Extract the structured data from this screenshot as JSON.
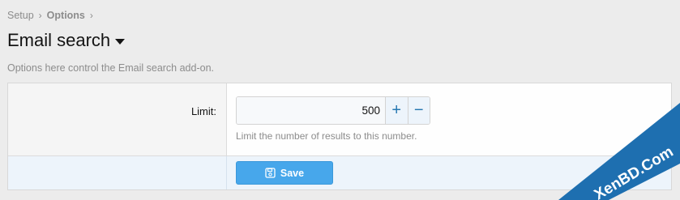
{
  "breadcrumb": {
    "items": [
      "Setup",
      "Options"
    ],
    "separator": "›"
  },
  "page": {
    "title": "Email search",
    "description": "Options here control the Email search add-on."
  },
  "form": {
    "limit_label": "Limit:",
    "limit_value": "500",
    "increment_symbol": "+",
    "decrement_symbol": "−",
    "limit_hint": "Limit the number of results to this number.",
    "save_label": "Save"
  },
  "watermark": {
    "text": "XenBD.Com",
    "color": "#1e6fb0"
  },
  "colors": {
    "accent": "#47a7eb",
    "stepper_text": "#2577b1",
    "muted_text": "#8c8c8c"
  },
  "icons": {
    "title_dropdown": "caret-down-icon",
    "save": "floppy-disk-icon"
  }
}
